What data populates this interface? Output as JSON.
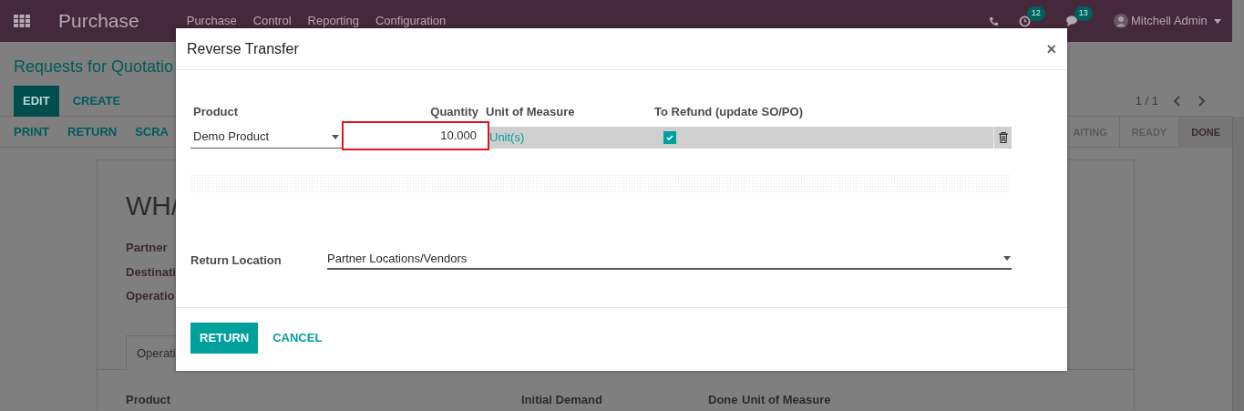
{
  "navbar": {
    "app": "Purchase",
    "menus": [
      "Purchase",
      "Control",
      "Reporting",
      "Configuration"
    ],
    "activity_count": "12",
    "message_count": "13",
    "user": "Mitchell Admin"
  },
  "control_panel": {
    "breadcrumb": "Requests for Quotatio",
    "buttons": [
      "EDIT",
      "CREATE"
    ],
    "pager": "1 / 1"
  },
  "actions": [
    "PRINT",
    "RETURN",
    "SCRA"
  ],
  "status_steps": [
    {
      "label": "AITING",
      "selected": false
    },
    {
      "label": "READY",
      "selected": false
    },
    {
      "label": "DONE",
      "selected": true
    }
  ],
  "sheet": {
    "title": "WH/",
    "fields": [
      "Partner",
      "Destinati",
      "Operatio"
    ],
    "tab": "Operati",
    "columns": [
      "Product",
      "Initial Demand",
      "Done",
      "Unit of Measure"
    ]
  },
  "dialog": {
    "title": "Reverse Transfer",
    "close": "×",
    "columns": [
      "Product",
      "Quantity",
      "Unit of Measure",
      "To Refund (update SO/PO)"
    ],
    "lines": [
      {
        "product": "Demo Product",
        "quantity": "10.000",
        "uom": "Unit(s)",
        "to_refund": true,
        "highlighted": true
      }
    ],
    "return_location_label": "Return Location",
    "return_location": "Partner Locations/Vendors",
    "buttons": [
      {
        "label": "RETURN",
        "kind": "primary"
      },
      {
        "label": "CANCEL",
        "kind": "link"
      }
    ]
  }
}
